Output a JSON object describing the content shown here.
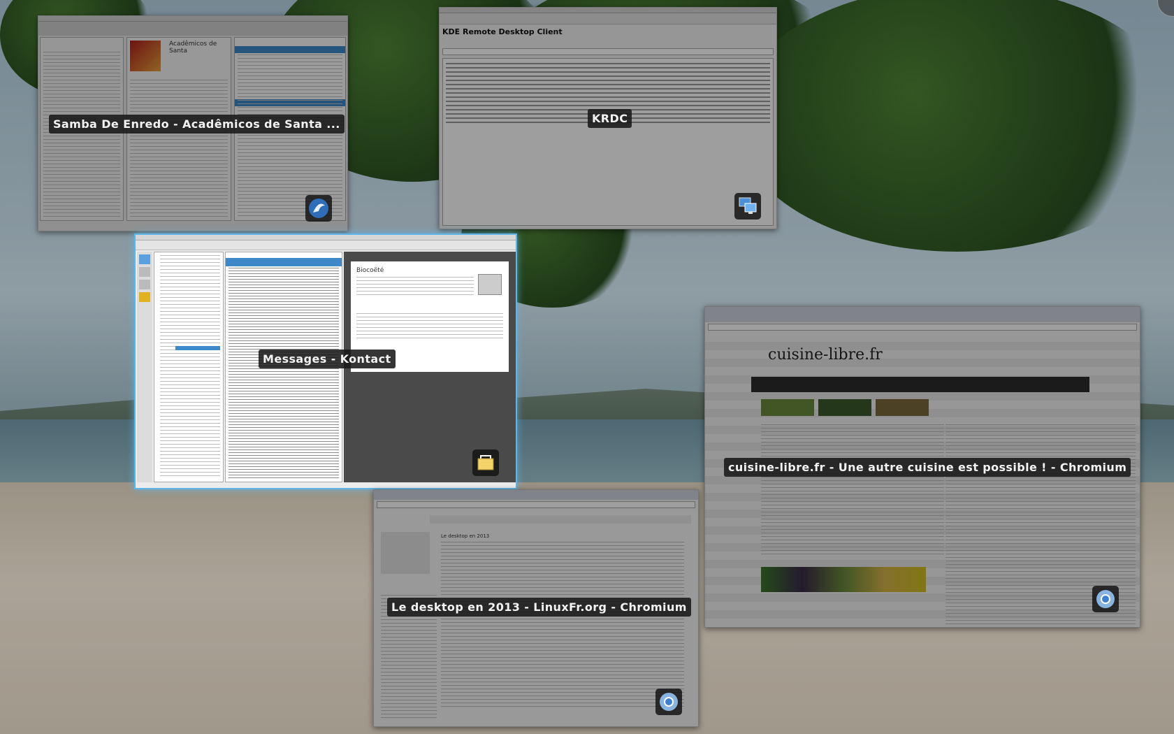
{
  "windows": [
    {
      "id": "amarok",
      "title": "Samba De Enredo - Acadêmicos de Santa ...",
      "content_title": "Acadêmicos de Santa",
      "icon": "amarok-icon"
    },
    {
      "id": "krdc",
      "title": "KRDC",
      "content_title": "KDE Remote Desktop Client",
      "icon": "remote-desktop-icon"
    },
    {
      "id": "kontact",
      "title": "Messages - Kontact",
      "content_title": "Biocoëté",
      "icon": "kontact-icon"
    },
    {
      "id": "cuisine",
      "title": "cuisine-libre.fr - Une autre cuisine est possible ! - Chromium",
      "content_title": "cuisine-libre.fr",
      "icon": "chromium-icon"
    },
    {
      "id": "linuxfr",
      "title": "Le desktop en 2013 - LinuxFr.org - Chromium",
      "content_title": "Le desktop en 2013",
      "icon": "chromium-icon"
    }
  ],
  "colors": {
    "active_border": "#5fb4e8",
    "caption_bg": "#191919"
  }
}
